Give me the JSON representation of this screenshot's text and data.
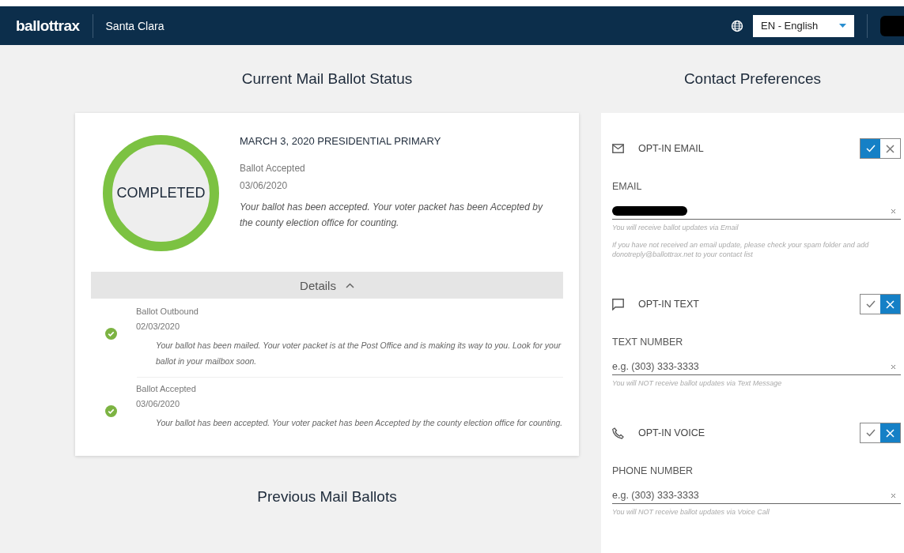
{
  "header": {
    "logo": "ballottrax",
    "county": "Santa Clara",
    "language": "EN - English"
  },
  "status": {
    "title": "Current Mail Ballot Status",
    "badge": "COMPLETED",
    "election": "MARCH 3, 2020 PRESIDENTIAL PRIMARY",
    "stage": "Ballot Accepted",
    "date": "03/06/2020",
    "message": "Your ballot has been accepted. Your voter packet has been Accepted by the county election office for counting.",
    "details": {
      "label": "Details",
      "expanded": true
    },
    "events": [
      {
        "title": "Ballot Outbound",
        "date": "02/03/2020",
        "message": "Your ballot has been mailed. Your voter packet is at the Post Office and is making its way to you. Look for your ballot in your mailbox soon."
      },
      {
        "title": "Ballot Accepted",
        "date": "03/06/2020",
        "message": "Your ballot has been accepted. Your voter packet has been Accepted by the county election office for counting."
      }
    ]
  },
  "previous": {
    "title": "Previous Mail Ballots"
  },
  "contact": {
    "title": "Contact Preferences",
    "channels": [
      {
        "kind": "email",
        "label": "OPT-IN EMAIL",
        "opted_in": true,
        "field_label": "EMAIL",
        "redacted": true,
        "notes": [
          "You will receive ballot updates via Email",
          "If you have not received an email update, please check your spam folder and add donotreply@ballottrax.net to your contact list"
        ]
      },
      {
        "kind": "text",
        "label": "OPT-IN TEXT",
        "opted_in": false,
        "field_label": "TEXT NUMBER",
        "placeholder": "e.g. (303) 333-3333",
        "notes": [
          "You will NOT receive ballot updates via Text Message"
        ]
      },
      {
        "kind": "voice",
        "label": "OPT-IN VOICE",
        "opted_in": false,
        "field_label": "PHONE NUMBER",
        "placeholder": "e.g. (303) 333-3333",
        "notes": [
          "You will NOT receive ballot updates via Voice Call"
        ]
      }
    ]
  }
}
